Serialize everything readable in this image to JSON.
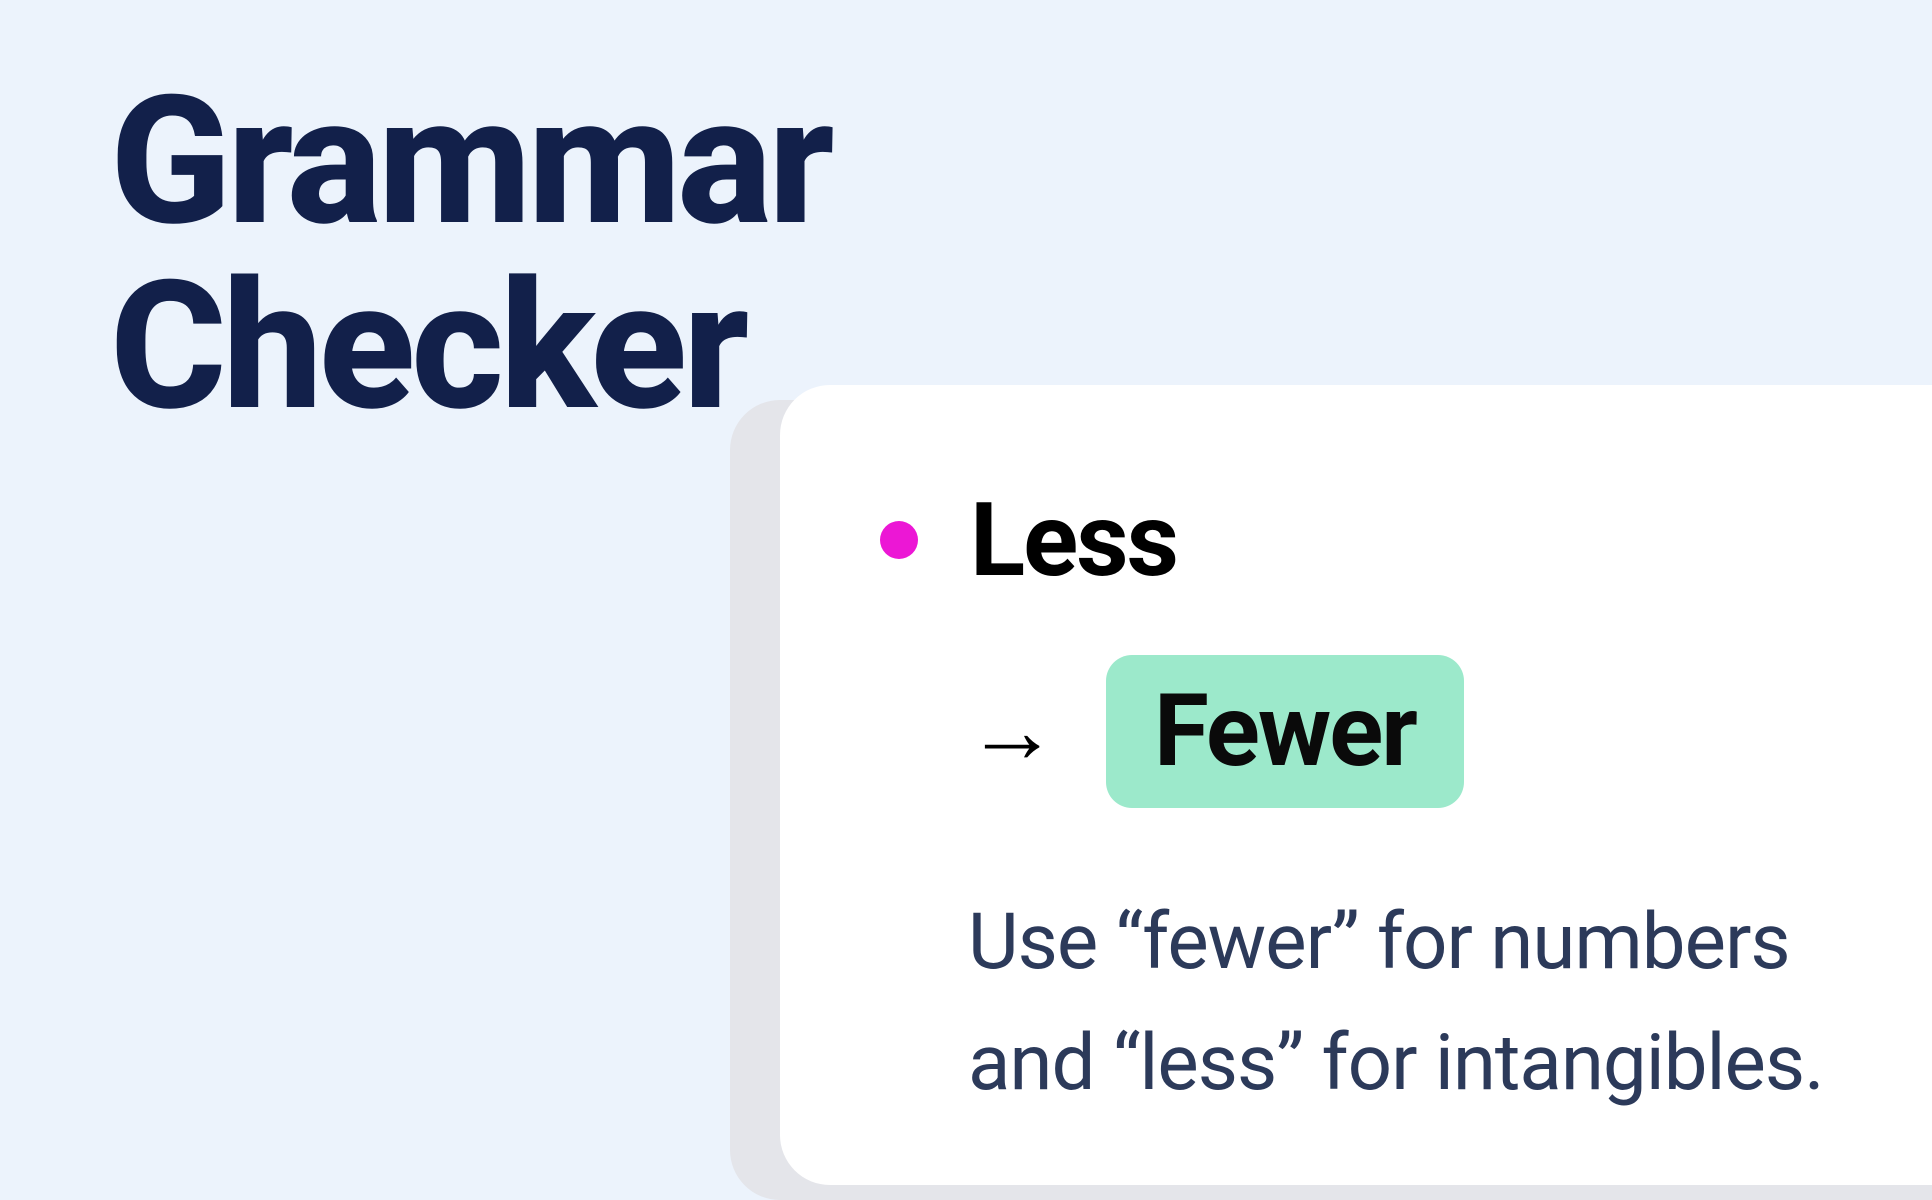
{
  "header": {
    "title_line1": "Grammar",
    "title_line2": "Checker"
  },
  "suggestion": {
    "original_word": "Less",
    "corrected_word": "Fewer",
    "explanation_line1": "Use “fewer” for numbers",
    "explanation_line2": "and “less” for intangibles.",
    "dot_color": "#ec17d5",
    "badge_color": "#9ce9cb"
  }
}
